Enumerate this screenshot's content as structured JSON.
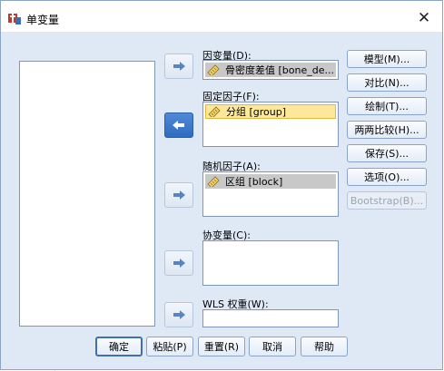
{
  "window": {
    "title": "单变量",
    "close_glyph": "✕"
  },
  "fields": {
    "dependent": {
      "label": "因变量(D):",
      "value": "骨密度差值 [bone_de..."
    },
    "fixed": {
      "label": "固定因子(F):",
      "items": [
        "分组 [group]"
      ]
    },
    "random": {
      "label": "随机因子(A):",
      "items": [
        "区组 [block]"
      ]
    },
    "covariate": {
      "label": "协变量(C):"
    },
    "wls": {
      "label": "WLS 权重(W):",
      "value": ""
    }
  },
  "side_buttons": [
    "模型(M)...",
    "对比(N)...",
    "绘制(T)...",
    "两两比较(H)...",
    "保存(S)...",
    "选项(O)...",
    "Bootstrap(B)..."
  ],
  "bottom_buttons": [
    "确定",
    "粘贴(P)",
    "重置(R)",
    "取消",
    "帮助"
  ],
  "icons": {
    "app": "spss-dialog-icon",
    "arrow": "move-arrow-icon",
    "variable": "scale-ruler-icon"
  },
  "colors": {
    "selected_item": "#fce79a",
    "active_arrow": "#2f6cc0",
    "dialog_bg": "#dfe9f5"
  }
}
